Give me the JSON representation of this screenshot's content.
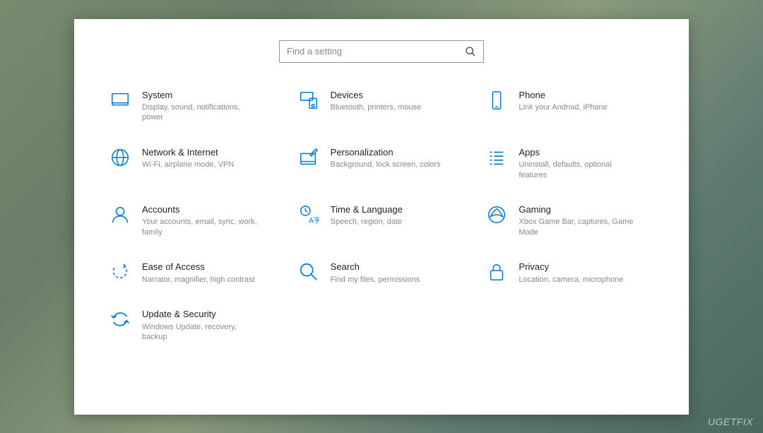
{
  "search": {
    "placeholder": "Find a setting"
  },
  "tiles": [
    {
      "id": "system",
      "title": "System",
      "desc": "Display, sound, notifications, power"
    },
    {
      "id": "devices",
      "title": "Devices",
      "desc": "Bluetooth, printers, mouse"
    },
    {
      "id": "phone",
      "title": "Phone",
      "desc": "Link your Android, iPhone"
    },
    {
      "id": "network",
      "title": "Network & Internet",
      "desc": "Wi-Fi, airplane mode, VPN"
    },
    {
      "id": "personalization",
      "title": "Personalization",
      "desc": "Background, lock screen, colors"
    },
    {
      "id": "apps",
      "title": "Apps",
      "desc": "Uninstall, defaults, optional features"
    },
    {
      "id": "accounts",
      "title": "Accounts",
      "desc": "Your accounts, email, sync, work, family"
    },
    {
      "id": "time",
      "title": "Time & Language",
      "desc": "Speech, region, date"
    },
    {
      "id": "gaming",
      "title": "Gaming",
      "desc": "Xbox Game Bar, captures, Game Mode"
    },
    {
      "id": "ease",
      "title": "Ease of Access",
      "desc": "Narrator, magnifier, high contrast"
    },
    {
      "id": "search",
      "title": "Search",
      "desc": "Find my files, permissions"
    },
    {
      "id": "privacy",
      "title": "Privacy",
      "desc": "Location, camera, microphone"
    },
    {
      "id": "update",
      "title": "Update & Security",
      "desc": "Windows Update, recovery, backup"
    }
  ],
  "accent_color": "#0078d4",
  "watermark": "UGETFIX"
}
